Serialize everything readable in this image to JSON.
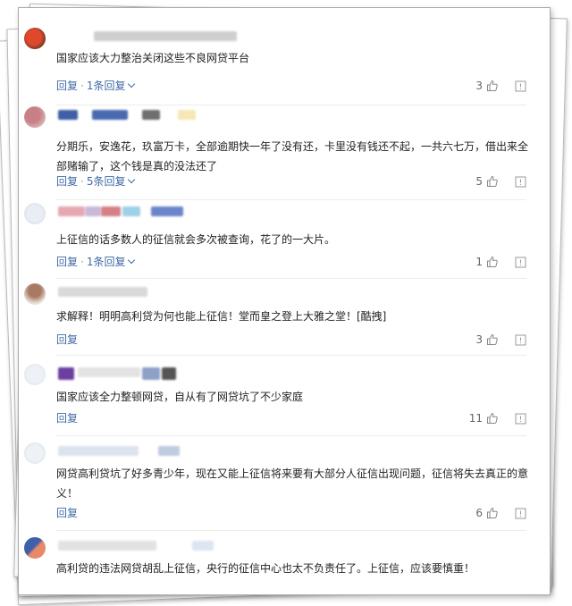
{
  "labels": {
    "reply": "回复",
    "separator": "·"
  },
  "colors": {
    "link": "#3f6ba6",
    "text": "#222222",
    "muted": "#666666"
  },
  "comments": [
    {
      "text": "国家应该大力整治关闭这些不良网贷平台",
      "replies": "1条回复",
      "likes": "3"
    },
    {
      "text": "分期乐，安逸花，玖富万卡，全部逾期快一年了没有还，卡里没有钱还不起，一共六七万，借出来全部赌输了，这个钱是真的没法还了",
      "replies": "5条回复",
      "likes": "5"
    },
    {
      "text": "上征信的话多数人的征信就会多次被查询，花了的一大片。",
      "replies": "1条回复",
      "likes": "1"
    },
    {
      "text": "求解释！明明高利贷为何也能上征信！堂而皇之登上大雅之堂！[酷拽]",
      "likes": "3"
    },
    {
      "text": "国家应该全力整顿网贷，自从有了网贷坑了不少家庭",
      "likes": "11"
    },
    {
      "text": "网贷高利贷坑了好多青少年，现在又能上征信将来要有大部分人征信出现问题，征信将失去真正的意义！",
      "likes": "6"
    },
    {
      "text": "高利贷的违法网贷胡乱上征信，央行的征信中心也太不负责任了。上征信，应该要慎重！"
    }
  ],
  "icons": {
    "like": "thumbs-up-icon",
    "report": "flag-box-icon",
    "expand": "chevron-down-icon"
  }
}
